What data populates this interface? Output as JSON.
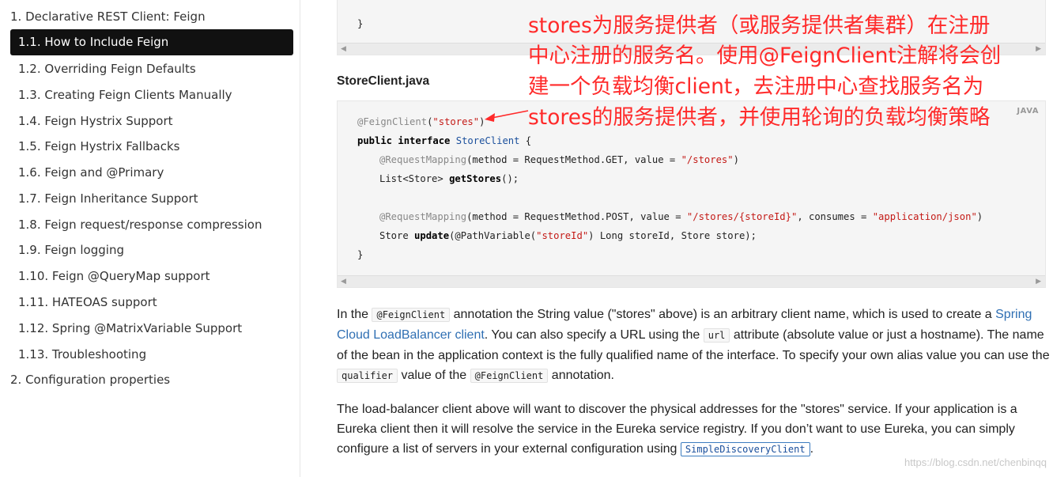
{
  "toc": {
    "items": [
      {
        "label": "1. Declarative REST Client: Feign",
        "level": 1,
        "active": false
      },
      {
        "label": "1.1. How to Include Feign",
        "level": 2,
        "active": true
      },
      {
        "label": "1.2. Overriding Feign Defaults",
        "level": 2,
        "active": false
      },
      {
        "label": "1.3. Creating Feign Clients Manually",
        "level": 2,
        "active": false
      },
      {
        "label": "1.4. Feign Hystrix Support",
        "level": 2,
        "active": false
      },
      {
        "label": "1.5. Feign Hystrix Fallbacks",
        "level": 2,
        "active": false
      },
      {
        "label": "1.6. Feign and @Primary",
        "level": 2,
        "active": false
      },
      {
        "label": "1.7. Feign Inheritance Support",
        "level": 2,
        "active": false
      },
      {
        "label": "1.8. Feign request/response compression",
        "level": 2,
        "active": false
      },
      {
        "label": "1.9. Feign logging",
        "level": 2,
        "active": false
      },
      {
        "label": "1.10. Feign @QueryMap support",
        "level": 2,
        "active": false
      },
      {
        "label": "1.11. HATEOAS support",
        "level": 2,
        "active": false
      },
      {
        "label": "1.12. Spring @MatrixVariable Support",
        "level": 2,
        "active": false
      },
      {
        "label": "1.13. Troubleshooting",
        "level": 2,
        "active": false
      },
      {
        "label": "2. Configuration properties",
        "level": 1,
        "active": false
      }
    ]
  },
  "code_top": {
    "closing_brace": "}"
  },
  "file_title": "StoreClient.java",
  "code_main": {
    "lang": "JAVA",
    "l1_annot": "@FeignClient",
    "l1_open": "(",
    "l1_str": "\"stores\"",
    "l1_close": ")",
    "l2_kw": "public interface",
    "l2_type": "StoreClient",
    "l2_brace": " {",
    "l3_annot": "@RequestMapping",
    "l3_args": "(method = RequestMethod.GET, value = ",
    "l3_str": "\"/stores\"",
    "l3_close": ")",
    "l4_type": "List<Store>",
    "l4_fn": "getStores",
    "l4_rest": "();",
    "l5_annot": "@RequestMapping",
    "l5_args": "(method = RequestMethod.POST, value = ",
    "l5_str1": "\"/stores/{storeId}\"",
    "l5_mid": ", consumes = ",
    "l5_str2": "\"application/json\"",
    "l5_close": ")",
    "l6_type": "Store",
    "l6_fn": "update",
    "l6_open": "(@PathVariable(",
    "l6_str": "\"storeId\"",
    "l6_rest": ") Long storeId, Store store);",
    "l7": "}"
  },
  "para1": {
    "t1": "In the ",
    "c1": "@FeignClient",
    "t2": " annotation the String value (\"stores\" above) is an arbitrary client name, which is used to create a ",
    "link": "Spring Cloud LoadBalancer client",
    "t3": ". You can also specify a URL using the ",
    "c2": "url",
    "t4": " attribute (absolute value or just a hostname). The name of the bean in the application context is the fully qualified name of the interface. To specify your own alias value you can use the ",
    "c3": "qualifier",
    "t5": " value of the ",
    "c4": "@FeignClient",
    "t6": " annotation."
  },
  "para2": {
    "t1": "The load-balancer client above will want to discover the physical addresses for the \"stores\" service. If your application is a Eureka client then it will resolve the service in the Eureka service registry. If you don’t want to use Eureka, you can simply configure a list of servers in your external configuration using ",
    "c1": "SimpleDiscoveryClient",
    "t2": "."
  },
  "annotation_note": {
    "lines": [
      "stores为服务提供者（或服务提供者集群）在注册",
      "中心注册的服务名。使用@FeignClient注解将会创",
      "建一个负载均衡client，去注册中心查找服务名为",
      "stores的服务提供者，并使用轮询的负载均衡策略"
    ],
    "color": "#ff2a2a"
  },
  "watermark": "https://blog.csdn.net/chenbinqq",
  "icons": {
    "scroll_left": "triangle-left",
    "scroll_right": "triangle-right"
  }
}
